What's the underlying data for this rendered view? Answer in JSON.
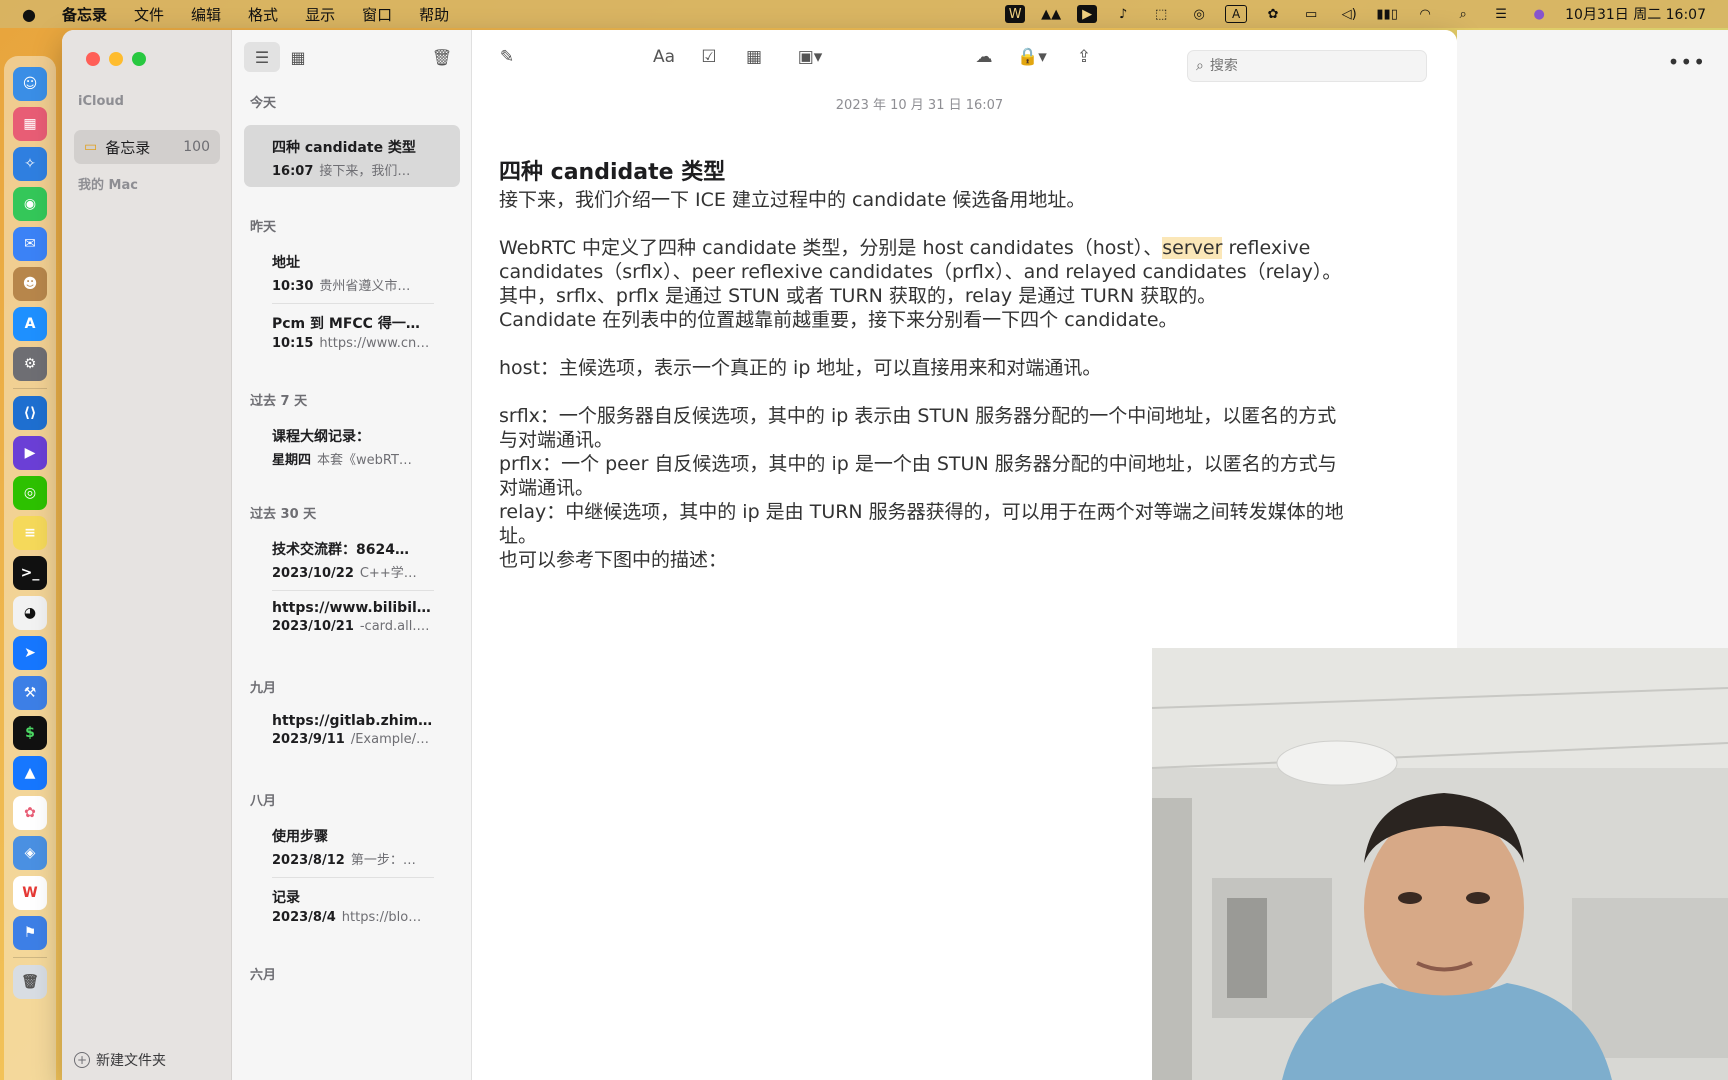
{
  "menubar": {
    "app_name": "备忘录",
    "menus": [
      "文件",
      "编辑",
      "格式",
      "显示",
      "窗口",
      "帮助"
    ],
    "clock": "10月31日 周二 16:07"
  },
  "sidebar": {
    "icloud_label": "iCloud",
    "folder_name": "备忘录",
    "folder_count": "100",
    "mac_label": "我的 Mac",
    "new_folder": "新建文件夹"
  },
  "notelist": {
    "groups": [
      "今天",
      "昨天",
      "过去 7 天",
      "过去 30 天",
      "九月",
      "八月",
      "六月"
    ],
    "notes": [
      {
        "title": "四种 candidate 类型",
        "date": "16:07",
        "preview": "接下来，我们…"
      },
      {
        "title": "地址",
        "date": "10:30",
        "preview": "贵州省遵义市…"
      },
      {
        "title": "Pcm 到 MFCC 得一…",
        "date": "10:15",
        "preview": "https://www.cn…"
      },
      {
        "title": "课程大纲记录：",
        "date": "星期四",
        "preview": "本套《webRT…"
      },
      {
        "title": "技术交流群：8624…",
        "date": "2023/10/22",
        "preview": "C++学…"
      },
      {
        "title": "https://www.bilibil…",
        "date": "2023/10/21",
        "preview": "-card.all.…"
      },
      {
        "title": "https://gitlab.zhim…",
        "date": "2023/9/11",
        "preview": "/Example/…"
      },
      {
        "title": "使用步骤",
        "date": "2023/8/12",
        "preview": "第一步：…"
      },
      {
        "title": "记录",
        "date": "2023/8/4",
        "preview": "https://blo…"
      }
    ]
  },
  "editor": {
    "format_label": "Aa",
    "search_placeholder": "搜索",
    "date": "2023 年 10 月 31 日 16:07",
    "title": "四种 candidate 类型",
    "lines": {
      "l1": "接下来，我们介绍一下 ICE 建立过程中的 candidate 候选备用地址。",
      "l2a": "WebRTC 中定义了四种 candidate 类型，分别是 host candidates（host）、",
      "l2hl": "server",
      "l2b": " reflexive candidates（srflx）、peer reflexive candidates（prflx）、and relayed candidates（relay）。",
      "l3": "其中，srflx、prflx 是通过 STUN 或者 TURN 获取的，relay 是通过 TURN 获取的。",
      "l4": "Candidate 在列表中的位置越靠前越重要，接下来分别看一下四个 candidate。",
      "l5": "host：主候选项，表示一个真正的 ip 地址，可以直接用来和对端通讯。",
      "l6": "srflx：一个服务器自反候选项，其中的 ip 表示由 STUN 服务器分配的一个中间地址，以匿名的方式与对端通讯。",
      "l7": "prflx：一个 peer 自反候选项，其中的 ip 是一个由 STUN 服务器分配的中间地址，以匿名的方式与对端通讯。",
      "l8": "relay：中继候选项，其中的 ip 是由 TURN 服务器获得的，可以用于在两个对等端之间转发媒体的地址。",
      "l9": "也可以参考下图中的描述："
    }
  },
  "colors": {
    "traffic_red": "#ff5f57",
    "traffic_yellow": "#febc2e",
    "traffic_green": "#28c840",
    "folder_icon": "#e0a020",
    "highlight": "#fbe7b8"
  }
}
